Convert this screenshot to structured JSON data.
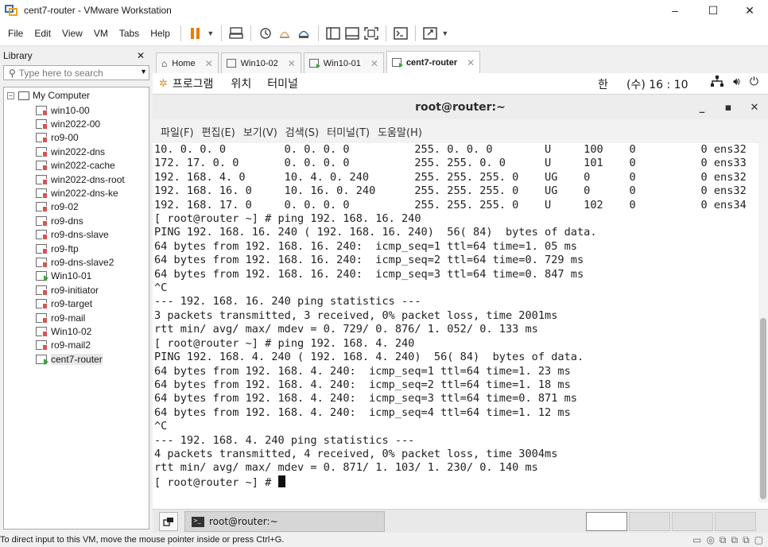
{
  "window": {
    "title": "cent7-router - VMware Workstation",
    "controls": {
      "minimize": "–",
      "maximize": "☐",
      "close": "✕"
    }
  },
  "menu": {
    "items": [
      "File",
      "Edit",
      "View",
      "VM",
      "Tabs",
      "Help"
    ]
  },
  "library": {
    "title": "Library",
    "close": "✕",
    "search_placeholder": "Type here to search",
    "root": "My Computer",
    "vms": [
      {
        "name": "win10-00",
        "state": "off"
      },
      {
        "name": "win2022-00",
        "state": "off"
      },
      {
        "name": "ro9-00",
        "state": "off"
      },
      {
        "name": "win2022-dns",
        "state": "off"
      },
      {
        "name": "win2022-cache",
        "state": "off"
      },
      {
        "name": "win2022-dns-root",
        "state": "off"
      },
      {
        "name": "win2022-dns-ke",
        "state": "off"
      },
      {
        "name": "ro9-02",
        "state": "off"
      },
      {
        "name": "ro9-dns",
        "state": "off"
      },
      {
        "name": "ro9-dns-slave",
        "state": "off"
      },
      {
        "name": "ro9-ftp",
        "state": "off"
      },
      {
        "name": "ro9-dns-slave2",
        "state": "off"
      },
      {
        "name": "Win10-01",
        "state": "on"
      },
      {
        "name": "ro9-initiator",
        "state": "off"
      },
      {
        "name": "ro9-target",
        "state": "off"
      },
      {
        "name": "ro9-mail",
        "state": "off"
      },
      {
        "name": "Win10-02",
        "state": "off"
      },
      {
        "name": "ro9-mail2",
        "state": "off"
      },
      {
        "name": "cent7-router",
        "state": "on"
      }
    ]
  },
  "tabs": [
    {
      "label": "Home",
      "icon": "home-icon"
    },
    {
      "label": "Win10-02",
      "icon": "vm-off-icon"
    },
    {
      "label": "Win10-01",
      "icon": "vm-on-icon"
    },
    {
      "label": "cent7-router",
      "icon": "vm-on-icon",
      "active": true
    }
  ],
  "gnome": {
    "apps": "프로그램",
    "places": "위치",
    "terminal": "터미널",
    "ime": "한",
    "clock": "(수) 16 : 10"
  },
  "terminal": {
    "title": "root@router:~",
    "menu": [
      "파일(F)",
      "편집(E)",
      "보기(V)",
      "검색(S)",
      "터미널(T)",
      "도움말(H)"
    ],
    "lines": [
      "10. 0. 0. 0         0. 0. 0. 0          255. 0. 0. 0        U     100    0          0 ens32",
      "172. 17. 0. 0       0. 0. 0. 0          255. 255. 0. 0      U     101    0          0 ens33",
      "192. 168. 4. 0      10. 4. 0. 240       255. 255. 255. 0    UG    0      0          0 ens32",
      "192. 168. 16. 0     10. 16. 0. 240      255. 255. 255. 0    UG    0      0          0 ens32",
      "192. 168. 17. 0     0. 0. 0. 0          255. 255. 255. 0    U     102    0          0 ens34",
      "[ root@router ~] # ping 192. 168. 16. 240",
      "PING 192. 168. 16. 240 ( 192. 168. 16. 240)  56( 84)  bytes of data.",
      "64 bytes from 192. 168. 16. 240:  icmp_seq=1 ttl=64 time=1. 05 ms",
      "64 bytes from 192. 168. 16. 240:  icmp_seq=2 ttl=64 time=0. 729 ms",
      "64 bytes from 192. 168. 16. 240:  icmp_seq=3 ttl=64 time=0. 847 ms",
      "^C",
      "--- 192. 168. 16. 240 ping statistics ---",
      "3 packets transmitted, 3 received, 0% packet loss, time 2001ms",
      "rtt min/ avg/ max/ mdev = 0. 729/ 0. 876/ 1. 052/ 0. 133 ms",
      "[ root@router ~] # ping 192. 168. 4. 240",
      "PING 192. 168. 4. 240 ( 192. 168. 4. 240)  56( 84)  bytes of data.",
      "64 bytes from 192. 168. 4. 240:  icmp_seq=1 ttl=64 time=1. 23 ms",
      "64 bytes from 192. 168. 4. 240:  icmp_seq=2 ttl=64 time=1. 18 ms",
      "64 bytes from 192. 168. 4. 240:  icmp_seq=3 ttl=64 time=0. 871 ms",
      "64 bytes from 192. 168. 4. 240:  icmp_seq=4 ttl=64 time=1. 12 ms",
      "^C",
      "--- 192. 168. 4. 240 ping statistics ---",
      "4 packets transmitted, 4 received, 0% packet loss, time 3004ms",
      "rtt min/ avg/ max/ mdev = 0. 871/ 1. 103/ 1. 230/ 0. 140 ms"
    ],
    "prompt": "[ root@router ~] # "
  },
  "taskbar": {
    "task_label": "root@router:~"
  },
  "status": {
    "message": "To direct input to this VM, move the mouse pointer inside or press Ctrl+G."
  }
}
